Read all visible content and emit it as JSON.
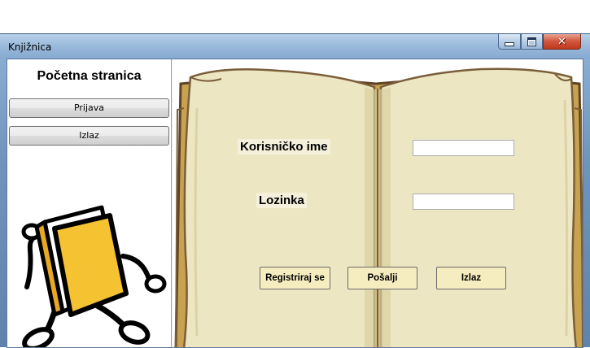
{
  "window": {
    "title": "Knjižnica",
    "controls": {
      "minimize": "minimize",
      "maximize": "maximize",
      "close": "✕"
    }
  },
  "sidebar": {
    "heading": "Početna stranica",
    "items": [
      {
        "label": "Prijava"
      },
      {
        "label": "Izlaz"
      }
    ]
  },
  "login": {
    "username_label": "Korisničko ime",
    "password_label": "Lozinka",
    "username_value": "",
    "password_value": "",
    "buttons": {
      "register": "Registriraj se",
      "submit": "Pošalji",
      "exit": "Izlaz"
    }
  },
  "colors": {
    "book_page": "#ede6c3",
    "book_edge": "#7a5e3a",
    "book_cover": "#c8a24f",
    "mascot_book": "#f5c231",
    "button_fill": "#f5edbf"
  },
  "icons": {
    "mascot": "running-book-mascot-icon",
    "background": "open-book-illustration"
  }
}
